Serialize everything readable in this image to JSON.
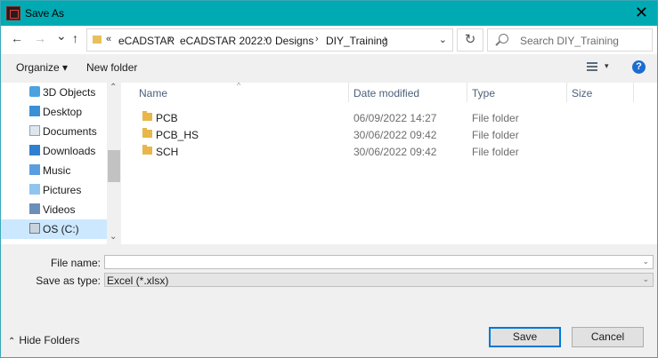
{
  "window": {
    "title": "Save As",
    "close_glyph": "✕"
  },
  "nav": {
    "back_glyph": "←",
    "forward_glyph": "→",
    "recent_glyph": "⌄",
    "up_glyph": "↑",
    "breadcrumb": [
      "eCADSTAR",
      "eCADSTAR 2022.0",
      "Designs",
      "DIY_Training"
    ],
    "crumb_sep": "›",
    "prefix_sep": "«",
    "dropdown_glyph": "⌄",
    "refresh_glyph": "↻",
    "search_placeholder": "Search DIY_Training"
  },
  "toolbar": {
    "organize_label": "Organize ▾",
    "new_folder_label": "New folder",
    "help_label": "?",
    "view_drop": "▾"
  },
  "sidebar": {
    "items": [
      {
        "label": "3D Objects",
        "icon": "3d-objects-icon"
      },
      {
        "label": "Desktop",
        "icon": "desktop-icon"
      },
      {
        "label": "Documents",
        "icon": "documents-icon"
      },
      {
        "label": "Downloads",
        "icon": "downloads-icon"
      },
      {
        "label": "Music",
        "icon": "music-icon"
      },
      {
        "label": "Pictures",
        "icon": "pictures-icon"
      },
      {
        "label": "Videos",
        "icon": "videos-icon"
      },
      {
        "label": "OS (C:)",
        "icon": "drive-icon",
        "selected": true
      }
    ],
    "scroll_up": "⌃",
    "scroll_down": "⌄"
  },
  "files": {
    "columns": [
      "Name",
      "Date modified",
      "Type",
      "Size"
    ],
    "sort_glyph": "^",
    "rows": [
      {
        "name": "PCB",
        "date": "06/09/2022 14:27",
        "type": "File folder",
        "size": ""
      },
      {
        "name": "PCB_HS",
        "date": "30/06/2022 09:42",
        "type": "File folder",
        "size": ""
      },
      {
        "name": "SCH",
        "date": "30/06/2022 09:42",
        "type": "File folder",
        "size": ""
      }
    ]
  },
  "form": {
    "file_name_label": "File name:",
    "file_name_value": "",
    "save_type_label": "Save as type:",
    "save_type_value": "Excel (*.xlsx)",
    "dd_glyph": "⌄"
  },
  "footer": {
    "hide_folders_chev": "⌃",
    "hide_folders_label": "Hide Folders",
    "save_label": "Save",
    "cancel_label": "Cancel"
  },
  "colors": {
    "titlebar": "#00aab2",
    "selection": "#cce8ff",
    "accent": "#0078d7",
    "folder": "#e8b64a"
  }
}
